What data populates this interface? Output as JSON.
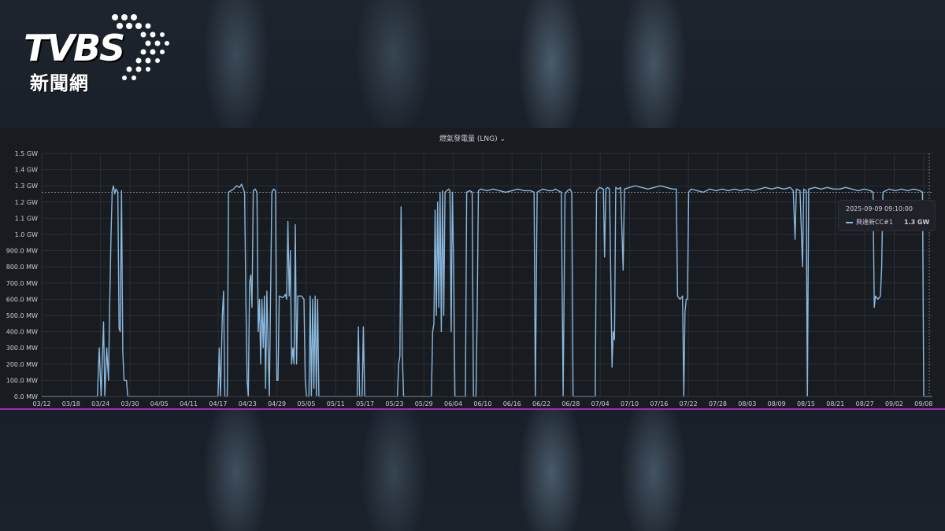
{
  "logo": {
    "brand": "TVBS",
    "sub": "新聞網"
  },
  "panel": {
    "title": "燃氣發電量 (LNG)",
    "title_icon": "chevron-down-icon"
  },
  "tooltip": {
    "time": "2025-09-09 09:10:00",
    "series": "興達新CC#1",
    "value": "1.3 GW"
  },
  "colors": {
    "series": "#8ab8de",
    "panel_bg": "#181b1f",
    "grid": "#2a2e35",
    "text": "#ccccdc",
    "accent_border": "#a02bb5"
  },
  "chart_data": {
    "type": "line",
    "title": "燃氣發電量 (LNG)",
    "xlabel": "",
    "ylabel": "",
    "ylim": [
      0,
      1.5
    ],
    "unit": "GW",
    "grid": true,
    "legend": "tooltip",
    "x_ticks": [
      "03/12",
      "03/18",
      "03/24",
      "03/30",
      "04/05",
      "04/11",
      "04/17",
      "04/23",
      "04/29",
      "05/05",
      "05/11",
      "05/17",
      "05/23",
      "05/29",
      "06/04",
      "06/10",
      "06/16",
      "06/22",
      "06/28",
      "07/04",
      "07/10",
      "07/16",
      "07/22",
      "07/28",
      "08/03",
      "08/09",
      "08/15",
      "08/21",
      "08/27",
      "09/02",
      "09/08"
    ],
    "y_ticks": [
      "0.0 MW",
      "100.0 MW",
      "200.0 MW",
      "300.0 MW",
      "400.0 MW",
      "500.0 MW",
      "600.0 MW",
      "700.0 MW",
      "800.0 MW",
      "900.0 MW",
      "1.0 GW",
      "1.1 GW",
      "1.2 GW",
      "1.3 GW",
      "1.4 GW",
      "1.5 GW"
    ],
    "threshold": 1.26,
    "series": [
      {
        "name": "興達新CC#1",
        "x_day_values_note": "",
        "points": [
          [
            0,
            0
          ],
          [
            9,
            0
          ],
          [
            9.3,
            0.3
          ],
          [
            9.6,
            0
          ],
          [
            10,
            0.46
          ],
          [
            10.2,
            0
          ],
          [
            10.5,
            0.3
          ],
          [
            10.8,
            0.1
          ],
          [
            11,
            0.6
          ],
          [
            11.2,
            1.0
          ],
          [
            11.4,
            1.27
          ],
          [
            11.6,
            1.3
          ],
          [
            11.8,
            1.25
          ],
          [
            12,
            1.28
          ],
          [
            12.3,
            1.26
          ],
          [
            12.5,
            0.42
          ],
          [
            12.7,
            0.4
          ],
          [
            12.9,
            1.27
          ],
          [
            13.1,
            0.28
          ],
          [
            13.3,
            0.1
          ],
          [
            13.7,
            0.1
          ],
          [
            13.9,
            0
          ],
          [
            28.5,
            0
          ],
          [
            28.7,
            0.3
          ],
          [
            28.9,
            0
          ],
          [
            29.2,
            0.5
          ],
          [
            29.4,
            0.65
          ],
          [
            29.6,
            0
          ],
          [
            30,
            0
          ],
          [
            30.2,
            1.26
          ],
          [
            30.6,
            1.27
          ],
          [
            31,
            1.28
          ],
          [
            31.5,
            1.3
          ],
          [
            32,
            1.29
          ],
          [
            32.3,
            1.31
          ],
          [
            32.6,
            1.28
          ],
          [
            32.8,
            1.26
          ],
          [
            33,
            0.6
          ],
          [
            33.2,
            0.1
          ],
          [
            33.4,
            0
          ],
          [
            33.6,
            0.7
          ],
          [
            33.8,
            0.75
          ],
          [
            34,
            0.55
          ],
          [
            34.2,
            1.27
          ],
          [
            34.5,
            1.28
          ],
          [
            34.8,
            1.26
          ],
          [
            35,
            0.4
          ],
          [
            35.2,
            0.6
          ],
          [
            35.4,
            0.2
          ],
          [
            35.6,
            0.6
          ],
          [
            35.8,
            0.3
          ],
          [
            36,
            0.62
          ],
          [
            36.2,
            0.05
          ],
          [
            36.4,
            0.65
          ],
          [
            36.6,
            0.3
          ],
          [
            36.8,
            0
          ],
          [
            37.2,
            1.26
          ],
          [
            37.5,
            1.28
          ],
          [
            37.8,
            1.27
          ],
          [
            38,
            0.1
          ],
          [
            38.2,
            0.1
          ],
          [
            38.4,
            0.62
          ],
          [
            39,
            0.61
          ],
          [
            39.4,
            0.63
          ],
          [
            39.6,
            0.6
          ],
          [
            39.8,
            1.08
          ],
          [
            40,
            0.62
          ],
          [
            40.2,
            0.9
          ],
          [
            40.4,
            0.2
          ],
          [
            40.6,
            0.3
          ],
          [
            40.8,
            0.2
          ],
          [
            41,
            1.06
          ],
          [
            41.2,
            0.2
          ],
          [
            41.4,
            0.62
          ],
          [
            42,
            0.62
          ],
          [
            42.4,
            0.6
          ],
          [
            42.6,
            0.1
          ],
          [
            42.8,
            0
          ],
          [
            43.2,
            0
          ],
          [
            43.4,
            0.62
          ],
          [
            43.6,
            0
          ],
          [
            43.8,
            0.6
          ],
          [
            44,
            0.05
          ],
          [
            44.2,
            0.62
          ],
          [
            44.4,
            0
          ],
          [
            44.6,
            0.6
          ],
          [
            44.8,
            0
          ],
          [
            51,
            0
          ],
          [
            51.2,
            0.43
          ],
          [
            51.4,
            0
          ],
          [
            51.8,
            0
          ],
          [
            52,
            0.43
          ],
          [
            52.2,
            0
          ],
          [
            57.5,
            0
          ],
          [
            57.7,
            0.2
          ],
          [
            57.9,
            0.25
          ],
          [
            58.1,
            1.17
          ],
          [
            58.3,
            0.25
          ],
          [
            58.5,
            0
          ],
          [
            63,
            0
          ],
          [
            63.2,
            0.4
          ],
          [
            63.4,
            0.45
          ],
          [
            63.6,
            1.15
          ],
          [
            63.8,
            0.5
          ],
          [
            64,
            1.2
          ],
          [
            64.2,
            0.55
          ],
          [
            64.4,
            1.26
          ],
          [
            64.6,
            0.4
          ],
          [
            64.8,
            1.27
          ],
          [
            65,
            0.5
          ],
          [
            65.2,
            1.26
          ],
          [
            65.5,
            1.27
          ],
          [
            65.8,
            1.28
          ],
          [
            66,
            1.27
          ],
          [
            66.2,
            0.4
          ],
          [
            66.4,
            1.26
          ],
          [
            66.6,
            0.8
          ],
          [
            66.8,
            0
          ],
          [
            68.5,
            0
          ],
          [
            68.7,
            1.26
          ],
          [
            69.2,
            1.27
          ],
          [
            69.6,
            1.26
          ],
          [
            69.8,
            0
          ],
          [
            70.2,
            0
          ],
          [
            70.4,
            0.5
          ],
          [
            70.6,
            1.27
          ],
          [
            71,
            1.28
          ],
          [
            72,
            1.27
          ],
          [
            73,
            1.28
          ],
          [
            74,
            1.27
          ],
          [
            75,
            1.26
          ],
          [
            76,
            1.27
          ],
          [
            77,
            1.28
          ],
          [
            78,
            1.27
          ],
          [
            79,
            1.27
          ],
          [
            79.6,
            1.26
          ],
          [
            79.8,
            0
          ],
          [
            80.1,
            1.26
          ],
          [
            81,
            1.28
          ],
          [
            82,
            1.27
          ],
          [
            82.6,
            1.27
          ],
          [
            83,
            1.28
          ],
          [
            83.5,
            1.27
          ],
          [
            84,
            1.26
          ],
          [
            84.3,
            0
          ],
          [
            84.6,
            1.25
          ],
          [
            85,
            1.27
          ],
          [
            85.4,
            1.28
          ],
          [
            85.7,
            1.26
          ],
          [
            85.9,
            0
          ],
          [
            89.5,
            0
          ],
          [
            89.7,
            1.27
          ],
          [
            90.2,
            1.29
          ],
          [
            90.8,
            1.28
          ],
          [
            91,
            0.86
          ],
          [
            91.2,
            1.28
          ],
          [
            91.5,
            1.29
          ],
          [
            91.8,
            1.28
          ],
          [
            92.2,
            0.18
          ],
          [
            92.4,
            0.4
          ],
          [
            92.6,
            0.35
          ],
          [
            92.8,
            1.29
          ],
          [
            93.2,
            1.28
          ],
          [
            93.6,
            1.29
          ],
          [
            94,
            0.78
          ],
          [
            94.2,
            1.28
          ],
          [
            95,
            1.29
          ],
          [
            96,
            1.3
          ],
          [
            97,
            1.29
          ],
          [
            98,
            1.28
          ],
          [
            99,
            1.29
          ],
          [
            100,
            1.3
          ],
          [
            101,
            1.29
          ],
          [
            102,
            1.28
          ],
          [
            102.6,
            1.28
          ],
          [
            102.8,
            0.62
          ],
          [
            103.2,
            0.6
          ],
          [
            103.6,
            0.62
          ],
          [
            103.8,
            0
          ],
          [
            104,
            0.52
          ],
          [
            104.2,
            0.6
          ],
          [
            104.4,
            0.6
          ],
          [
            104.6,
            1.26
          ],
          [
            105,
            1.28
          ],
          [
            106,
            1.27
          ],
          [
            107,
            1.26
          ],
          [
            108,
            1.28
          ],
          [
            109,
            1.27
          ],
          [
            110,
            1.28
          ],
          [
            111,
            1.27
          ],
          [
            112,
            1.28
          ],
          [
            113,
            1.27
          ],
          [
            114,
            1.28
          ],
          [
            115,
            1.27
          ],
          [
            116,
            1.28
          ],
          [
            117,
            1.29
          ],
          [
            118,
            1.28
          ],
          [
            119,
            1.29
          ],
          [
            120,
            1.28
          ],
          [
            121,
            1.29
          ],
          [
            121.5,
            1.27
          ],
          [
            121.8,
            0.97
          ],
          [
            122,
            1.28
          ],
          [
            122.6,
            1.27
          ],
          [
            123,
            0.8
          ],
          [
            123.2,
            1.28
          ],
          [
            123.6,
            1.27
          ],
          [
            123.8,
            0
          ],
          [
            124,
            1.28
          ],
          [
            125,
            1.29
          ],
          [
            126,
            1.28
          ],
          [
            127,
            1.29
          ],
          [
            128,
            1.28
          ],
          [
            129,
            1.28
          ],
          [
            130,
            1.29
          ],
          [
            131,
            1.28
          ],
          [
            132,
            1.27
          ],
          [
            133,
            1.28
          ],
          [
            134,
            1.27
          ],
          [
            134.4,
            1.26
          ],
          [
            134.6,
            0.55
          ],
          [
            134.8,
            0.62
          ],
          [
            135.2,
            0.6
          ],
          [
            135.6,
            0.62
          ],
          [
            135.8,
            0.8
          ],
          [
            136,
            1.26
          ],
          [
            137,
            1.28
          ],
          [
            138,
            1.27
          ],
          [
            139,
            1.28
          ],
          [
            140,
            1.27
          ],
          [
            141,
            1.28
          ],
          [
            142,
            1.27
          ],
          [
            142.4,
            1.26
          ],
          [
            142.6,
            0
          ],
          [
            144,
            0
          ]
        ]
      }
    ]
  }
}
